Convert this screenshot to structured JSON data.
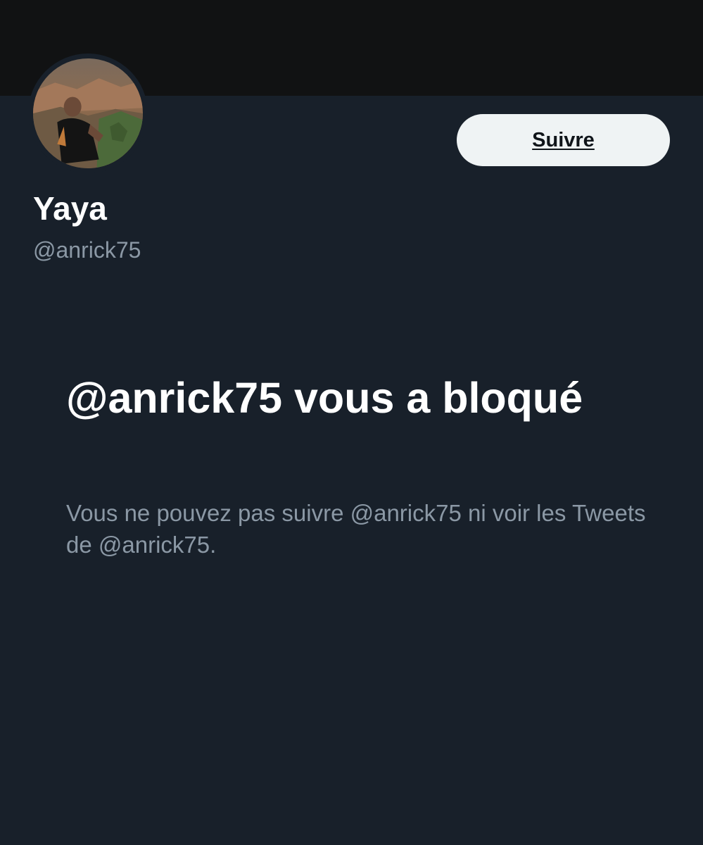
{
  "profile": {
    "display_name": "Yaya",
    "handle": "@anrick75",
    "follow_label": "Suivre"
  },
  "blocked": {
    "title": "@anrick75 vous a bloqué",
    "description": "Vous ne pouvez pas suivre @anrick75 ni voir les Tweets de @anrick75."
  },
  "colors": {
    "background": "#18202a",
    "banner": "#111213",
    "follow_button_bg": "#eff3f4",
    "primary_text": "#ffffff",
    "secondary_text": "#8b98a5"
  }
}
